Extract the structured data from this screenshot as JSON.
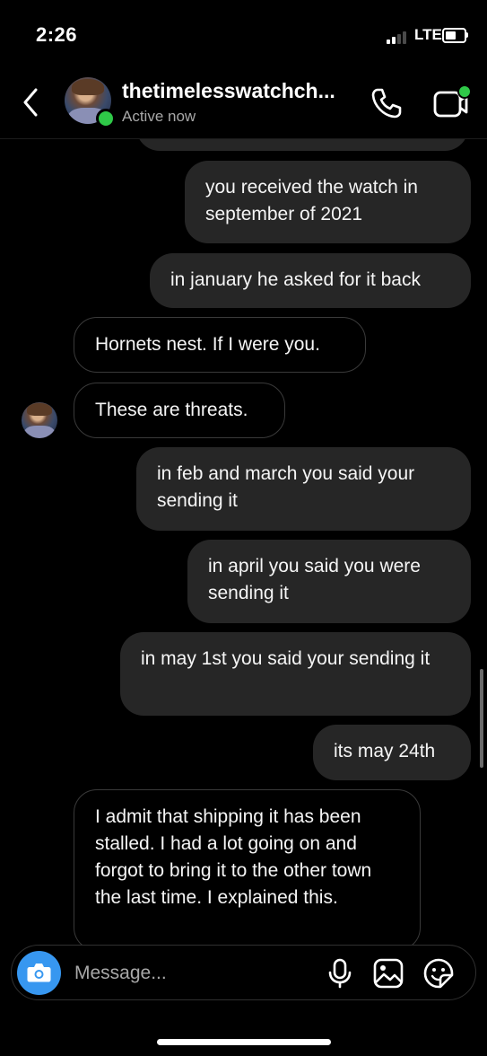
{
  "status_bar": {
    "time": "2:26",
    "network": "LTE"
  },
  "header": {
    "contact_name": "thetimelesswatchch...",
    "status": "Active now",
    "online_color": "#2fc948",
    "icons": [
      "back-chevron-icon",
      "phone-icon",
      "video-camera-icon"
    ]
  },
  "messages": [
    {
      "sender": "me",
      "text": "you received the watch in september of 2021"
    },
    {
      "sender": "me",
      "text": "in january he asked for it back"
    },
    {
      "sender": "them",
      "text": "Hornets nest. If I were you."
    },
    {
      "sender": "them",
      "text": "These are threats."
    },
    {
      "sender": "me",
      "text": "in feb and march you said your sending it"
    },
    {
      "sender": "me",
      "text": "in april you said you were sending it"
    },
    {
      "sender": "me",
      "text": "in may 1st you said your sending it"
    },
    {
      "sender": "me",
      "text": "its may 24th"
    },
    {
      "sender": "them",
      "text": "I admit that shipping it has been stalled. I had a lot going on and forgot to bring it to the other town the last time. I explained this."
    }
  ],
  "composer": {
    "placeholder": "Message...",
    "accent_color": "#3797f0",
    "icons": [
      "camera-icon",
      "microphone-icon",
      "gallery-icon",
      "sticker-icon"
    ]
  }
}
